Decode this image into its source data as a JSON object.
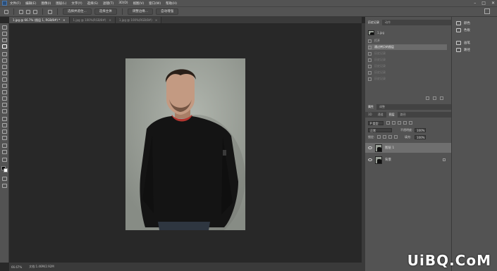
{
  "menubar": {
    "logo": "Ps",
    "items": [
      "文件(F)",
      "编辑(E)",
      "图像(I)",
      "图层(L)",
      "文字(Y)",
      "选择(S)",
      "滤镜(T)",
      "3D(D)",
      "视图(V)",
      "窗口(W)",
      "帮助(H)"
    ],
    "win": [
      "–",
      "□",
      "✕"
    ]
  },
  "options": {
    "btn1": "选择并遮住...",
    "btn2": "选择主体",
    "btn3": "调整边缘...",
    "btn4": "自动增强"
  },
  "tabs": [
    {
      "label": "1.jpg @ 66.7% (图层 1, RGB/8#) *"
    },
    {
      "label": "1.jpg @ 100%(RGB/8#)"
    },
    {
      "label": "1.jpg @ 100%(RGB/8#)"
    }
  ],
  "status": {
    "zoom": "66.67%",
    "doc": "文档:1.46M/2.92M"
  },
  "history": {
    "tabs": [
      "历史记录",
      "动作"
    ],
    "snapshot": "1.jpg",
    "rows": [
      {
        "label": "打开"
      },
      {
        "label": "通过拷贝的图层"
      },
      {
        "label": "历史记录"
      },
      {
        "label": "历史记录"
      },
      {
        "label": "历史记录"
      },
      {
        "label": "历史记录"
      },
      {
        "label": "历史记录"
      }
    ]
  },
  "layers": {
    "top_tabs": [
      "属性",
      "调整"
    ],
    "tabs": [
      "3D",
      "通道",
      "图层",
      "路径"
    ],
    "filter": "P 类型",
    "blend": "正常",
    "opacity_label": "不透明度:",
    "opacity": "100%",
    "lock_label": "锁定:",
    "fill_label": "填充:",
    "fill": "100%",
    "items": [
      {
        "name": "图层 1"
      },
      {
        "name": "背景"
      }
    ]
  },
  "side": {
    "items": [
      "颜色",
      "色板",
      "画笔",
      "路径"
    ]
  },
  "watermark": "UiBQ.CoM"
}
